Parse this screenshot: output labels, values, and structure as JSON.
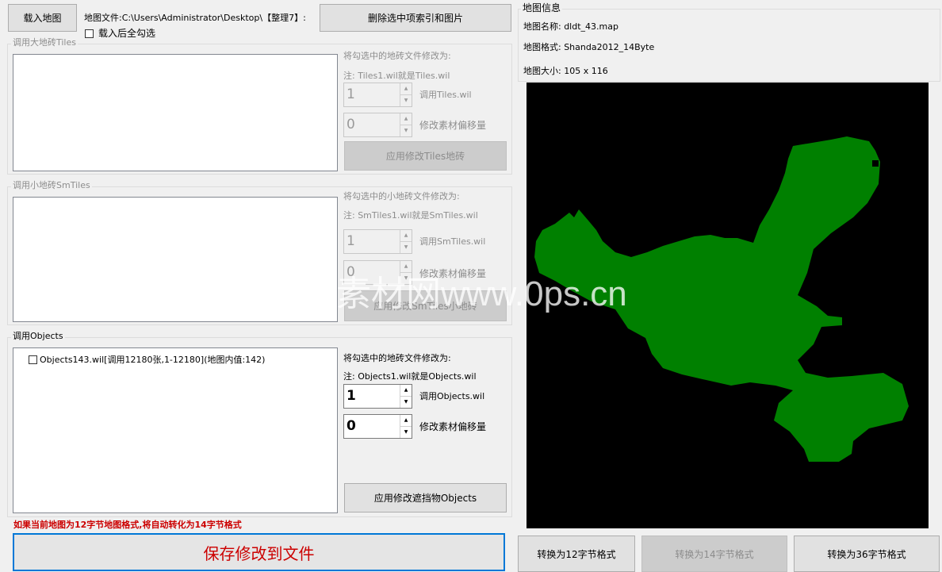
{
  "top": {
    "load_map_button": "载入地图",
    "map_file_label": "地图文件:C:\\Users\\Administrator\\Desktop\\【整理7】:",
    "delete_button": "删除选中项索引和图片",
    "select_all_after_load": "载入后全勾选"
  },
  "tiles": {
    "group_title": "调用大地砖Tiles",
    "modify_label": "将勾选中的地砖文件修改为:",
    "note": "注: Tiles1.wil就是Tiles.wil",
    "spin_value": "1",
    "spin_label": "调用Tiles.wil",
    "offset_value": "0",
    "offset_label": "修改素材偏移量",
    "apply_button": "应用修改Tiles地砖"
  },
  "smtiles": {
    "group_title": "调用小地砖SmTiles",
    "modify_label": "将勾选中的小地砖文件修改为:",
    "note": "注: SmTiles1.wil就是SmTiles.wil",
    "spin_value": "1",
    "spin_label": "调用SmTiles.wil",
    "offset_value": "0",
    "offset_label": "修改素材偏移量",
    "apply_button": "应用修改SmTiles小地砖"
  },
  "objects": {
    "group_title": "调用Objects",
    "items": [
      {
        "label": "Objects143.wil[调用12180张,1-12180](地图内值:142)"
      }
    ],
    "modify_label": "将勾选中的地砖文件修改为:",
    "note": "注: Objects1.wil就是Objects.wil",
    "spin_value": "1",
    "spin_label": "调用Objects.wil",
    "offset_value": "0",
    "offset_label": "修改素材偏移量",
    "apply_button": "应用修改遮挡物Objects"
  },
  "bottom": {
    "warning": "如果当前地图为12字节地图格式,将自动转化为14字节格式",
    "save_button": "保存修改到文件",
    "convert_12": "转换为12字节格式",
    "convert_14": "转换为14字节格式",
    "convert_36": "转换为36字节格式"
  },
  "map_info": {
    "group_title": "地图信息",
    "name_label": "地图名称: dldt_43.map",
    "format_label": "地图格式: Shanda2012_14Byte",
    "size_label": "地图大小: 105 x 116"
  },
  "watermark": "素材网www.0ps.cn",
  "colors": {
    "map_background": "#000000",
    "map_land": "#008000",
    "warning_text": "#cc0000",
    "save_text": "#cc0000",
    "primary_border": "#0078d7"
  }
}
